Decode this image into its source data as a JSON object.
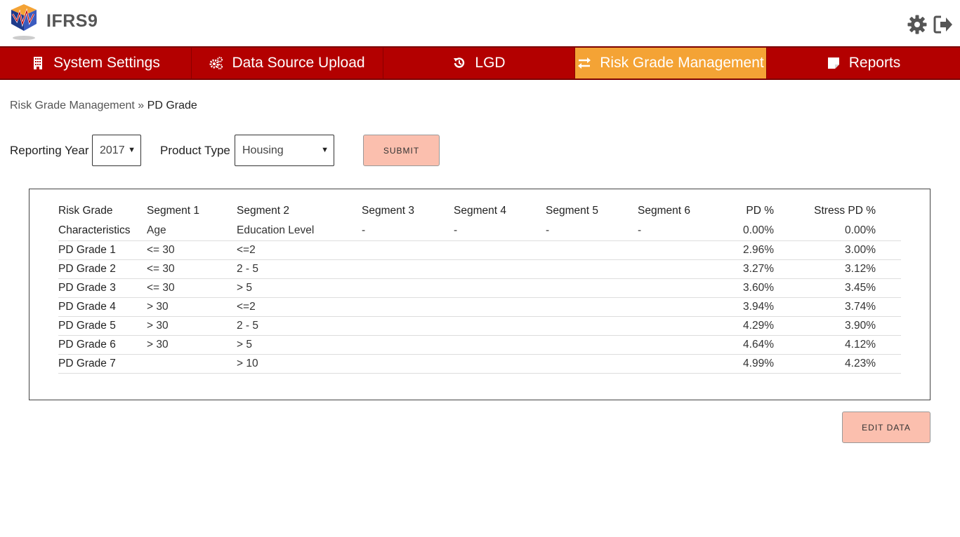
{
  "app": {
    "title": "IFRS9"
  },
  "header": {
    "settings_icon": "gear-icon",
    "logout_icon": "sign-out-icon"
  },
  "nav": {
    "items": [
      {
        "label": "System Settings",
        "icon": "building-icon"
      },
      {
        "label": "Data Source Upload",
        "icon": "cogs-icon"
      },
      {
        "label": "LGD",
        "icon": "history-icon"
      },
      {
        "label": "Risk Grade Management",
        "icon": "exchange-icon",
        "active": true
      },
      {
        "label": "Reports",
        "icon": "sticky-note-icon"
      }
    ],
    "active_color": "#f4a335",
    "bar_color": "#b30000"
  },
  "breadcrumb": {
    "parent": "Risk Grade Management",
    "separator": " » ",
    "current": "PD Grade"
  },
  "filters": {
    "year_label": "Reporting Year",
    "year_value": "2017",
    "product_label": "Product Type",
    "product_value": "Housing",
    "submit_label": "SUBMIT"
  },
  "table": {
    "headers": [
      "Risk Grade",
      "Segment 1",
      "Segment 2",
      "Segment 3",
      "Segment 4",
      "Segment 5",
      "Segment 6",
      "PD %",
      "Stress PD %"
    ],
    "rows": [
      [
        "Characteristics",
        "Age",
        "Education Level",
        "-",
        "-",
        "-",
        "-",
        "0.00%",
        "0.00%"
      ],
      [
        "PD Grade 1",
        "<= 30",
        "<=2",
        "",
        "",
        "",
        "",
        "2.96%",
        "3.00%"
      ],
      [
        "PD Grade 2",
        "<= 30",
        "2 - 5",
        "",
        "",
        "",
        "",
        "3.27%",
        "3.12%"
      ],
      [
        "PD Grade 3",
        "<= 30",
        "> 5",
        "",
        "",
        "",
        "",
        "3.60%",
        "3.45%"
      ],
      [
        "PD Grade 4",
        "> 30",
        "<=2",
        "",
        "",
        "",
        "",
        "3.94%",
        "3.74%"
      ],
      [
        "PD Grade 5",
        "> 30",
        "2 - 5",
        "",
        "",
        "",
        "",
        "4.29%",
        "3.90%"
      ],
      [
        "PD Grade 6",
        "> 30",
        "> 5",
        "",
        "",
        "",
        "",
        "4.64%",
        "4.12%"
      ],
      [
        "PD Grade 7",
        "",
        "> 10",
        "",
        "",
        "",
        "",
        "4.99%",
        "4.23%"
      ]
    ]
  },
  "actions": {
    "edit_label": "EDIT DATA",
    "button_color": "#fbbfae"
  }
}
